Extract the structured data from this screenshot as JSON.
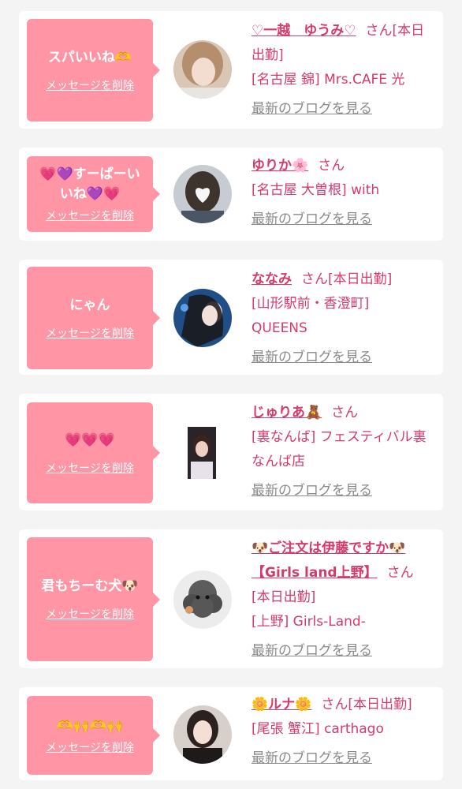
{
  "colors": {
    "bubble": "#ff95a5",
    "accent": "#d63a6a",
    "card": "#ffffff",
    "page": "#f4f4f4",
    "muted": "#8a8a8a"
  },
  "cards": [
    {
      "message": "スパいいね🫶",
      "delete_label": "メッセージを削除",
      "name": "♡一越　ゆうみ♡",
      "honorific": "さん",
      "status": "[本日出勤]",
      "shop": "[名古屋 錦] Mrs.CAFE 光",
      "blog_label": "最新のブログを見る",
      "avatar_icon": "profile-photo-icon"
    },
    {
      "message": "💗💜すーぱーいいね💜💗",
      "delete_label": "メッセージを削除",
      "name": "ゆりか🌸",
      "honorific": "さん",
      "status": "",
      "shop": "[名古屋 大曽根] with",
      "blog_label": "最新のブログを見る",
      "avatar_icon": "profile-photo-icon"
    },
    {
      "message": "にゃん",
      "delete_label": "メッセージを削除",
      "name": "ななみ",
      "honorific": "さん",
      "status": "[本日出勤]",
      "shop": "[山形駅前・香澄町] QUEENS",
      "blog_label": "最新のブログを見る",
      "avatar_icon": "profile-photo-icon"
    },
    {
      "message": "💗💗💗",
      "delete_label": "メッセージを削除",
      "name": "じゅりあ🧸",
      "honorific": "さん",
      "status": "",
      "shop": "[裏なんば] フェスティバル裏なんば店",
      "blog_label": "最新のブログを見る",
      "avatar_icon": "profile-photo-icon"
    },
    {
      "message": "君もちーむ犬🐶",
      "delete_label": "メッセージを削除",
      "name": "🐶ご注文は伊藤ですか🐶【Girls land上野】",
      "honorific": "さん",
      "status": "[本日出勤]",
      "shop": "[上野] Girls-Land-",
      "blog_label": "最新のブログを見る",
      "avatar_icon": "poodle-photo-icon"
    },
    {
      "message": "🫶🙌🫶🙌",
      "delete_label": "メッセージを削除",
      "name": "🌼ルナ🌼",
      "honorific": "さん",
      "status": "[本日出勤]",
      "shop": "[尾張 蟹江] carthago",
      "blog_label": "最新のブログを見る",
      "avatar_icon": "profile-photo-icon"
    }
  ]
}
